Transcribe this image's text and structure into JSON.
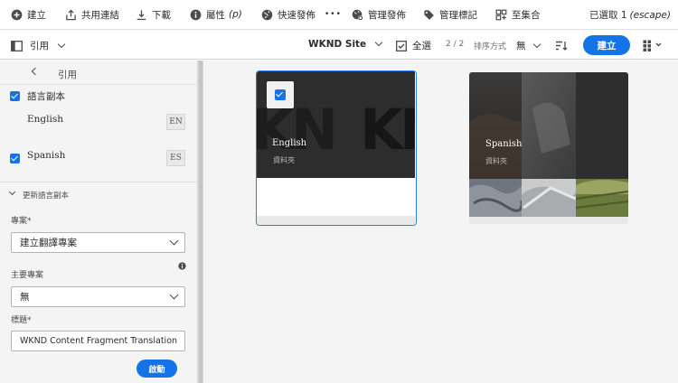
{
  "toolbar": {
    "create": "建立",
    "share_link": "共用連結",
    "download": "下載",
    "properties": "屬性",
    "properties_shortcut": "(p)",
    "quick_publish": "快速發佈",
    "more": "•••",
    "manage_publication": "管理發佈",
    "manage_tags": "管理標記",
    "to_collection": "至集合",
    "selected_text": "已選取 1",
    "escape_hint": "(escape)"
  },
  "secondary": {
    "rail_toggle_label": "引用",
    "site_name": "WKND Site",
    "select_all": "全選",
    "count": "2 / 2",
    "sort_label": "排序方式",
    "sort_value": "無",
    "create_button": "建立"
  },
  "rail": {
    "back_title": "引用",
    "language_copies_label": "語言副本",
    "languages": [
      {
        "name": "English",
        "code": "EN",
        "checked": false
      },
      {
        "name": "Spanish",
        "code": "ES",
        "checked": true
      }
    ],
    "update_section": "更新語言副本",
    "project_label": "專案*",
    "project_value": "建立翻譯專案",
    "master_project_label": "主要專案",
    "master_project_value": "無",
    "title_label": "標題*",
    "title_value": "WKND Content Fragment Translation",
    "start_button": "啟動"
  },
  "cards": [
    {
      "title": "English",
      "subtitle": "資料夾",
      "selected": true
    },
    {
      "title": "Spanish",
      "subtitle": "資料夾",
      "selected": false
    }
  ],
  "colors": {
    "accent": "#1473e6",
    "selection_border": "#2680eb"
  }
}
